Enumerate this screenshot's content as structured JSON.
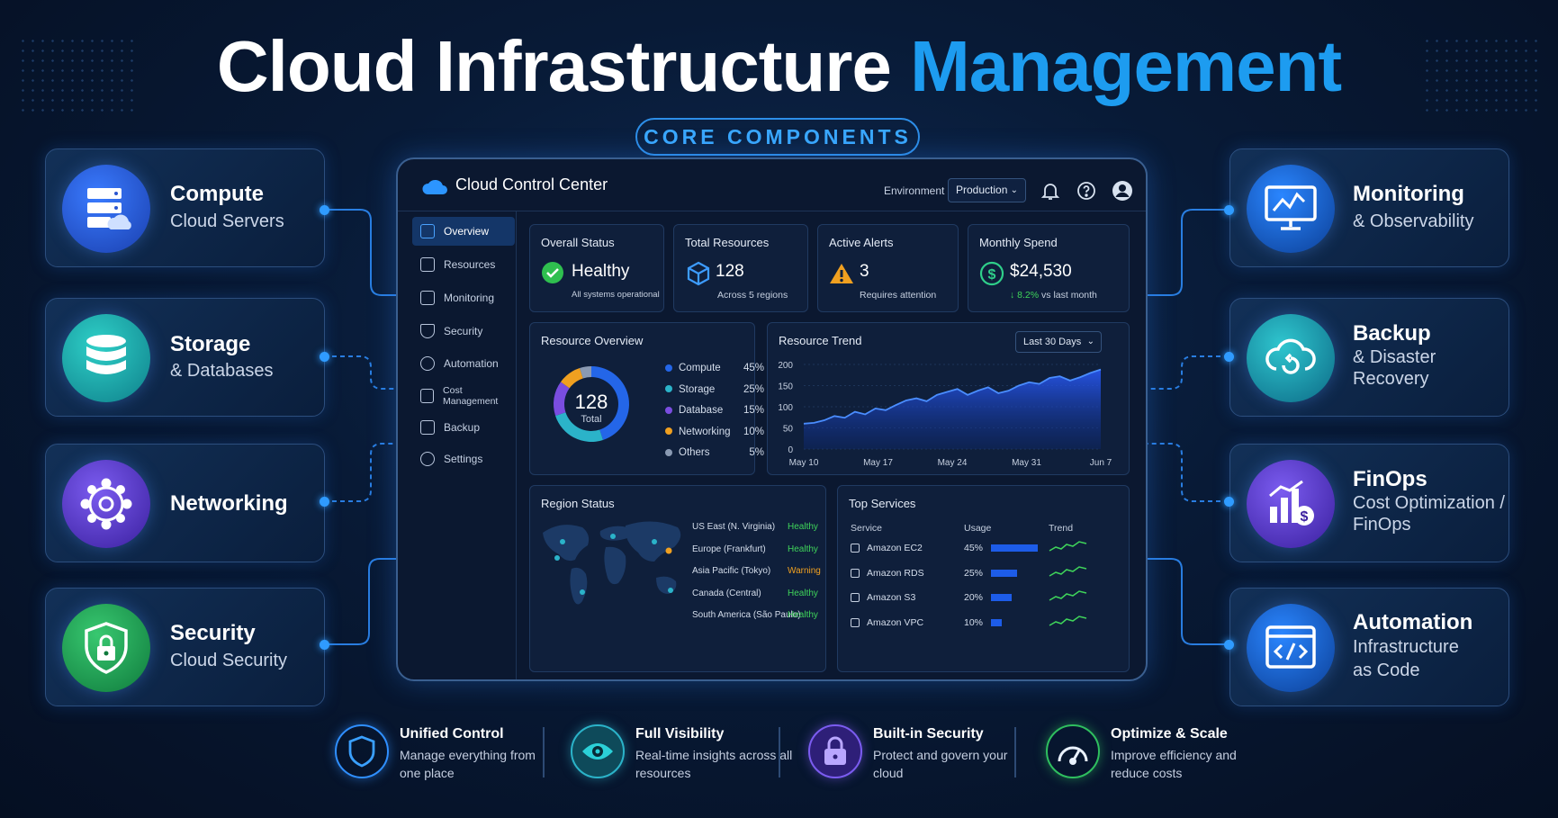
{
  "page_title": {
    "main": "Cloud Infrastructure",
    "accent": "Management"
  },
  "badge": "CORE COMPONENTS",
  "left_cards": [
    {
      "title": "Compute",
      "sub": [
        "Cloud Servers"
      ],
      "icon": "server-cloud-icon"
    },
    {
      "title": "Storage",
      "sub": [
        "& Databases"
      ],
      "icon": "database-icon"
    },
    {
      "title": "Networking",
      "sub": [],
      "icon": "network-hub-icon"
    },
    {
      "title": "Security",
      "sub": [
        "Cloud Security"
      ],
      "icon": "shield-lock-icon"
    }
  ],
  "right_cards": [
    {
      "title": "Monitoring",
      "sub": [
        "& Observability"
      ],
      "icon": "monitor-chart-icon"
    },
    {
      "title": "Backup",
      "sub": [
        "& Disaster",
        "Recovery"
      ],
      "icon": "cloud-backup-icon"
    },
    {
      "title": "FinOps",
      "sub": [
        "Cost Optimization /",
        "FinOps"
      ],
      "icon": "cost-chart-icon"
    },
    {
      "title": "Automation",
      "sub": [
        "Infrastructure",
        "as Code"
      ],
      "icon": "code-window-icon"
    }
  ],
  "dashboard": {
    "brand": "Cloud Control Center",
    "env_label": "Environment",
    "env_value": "Production",
    "nav": [
      "Overview",
      "Resources",
      "Monitoring",
      "Security",
      "Automation",
      "Cost Management",
      "Backup",
      "Settings"
    ],
    "kpis": [
      {
        "label": "Overall Status",
        "value": "Healthy",
        "sub": "All systems operational",
        "icon": "check-circle-icon"
      },
      {
        "label": "Total Resources",
        "value": "128",
        "sub": "Across 5 regions",
        "icon": "cube-icon"
      },
      {
        "label": "Active Alerts",
        "value": "3",
        "sub": "Requires attention",
        "icon": "warning-icon"
      },
      {
        "label": "Monthly Spend",
        "value": "$24,530",
        "sub_delta": "↓ 8.2%",
        "sub_rest": "vs last month",
        "icon": "dollar-icon"
      }
    ],
    "resource_overview": {
      "title": "Resource Overview",
      "center_value": "128",
      "center_label": "Total"
    },
    "resource_trend": {
      "title": "Resource Trend",
      "range": "Last 30 Days"
    },
    "region_status": {
      "title": "Region Status",
      "regions": [
        {
          "name": "US East (N. Virginia)",
          "status": "Healthy"
        },
        {
          "name": "Europe (Frankfurt)",
          "status": "Healthy"
        },
        {
          "name": "Asia Pacific (Tokyo)",
          "status": "Warning"
        },
        {
          "name": "Canada (Central)",
          "status": "Healthy"
        },
        {
          "name": "South America (São Paulo)",
          "status": "Healthy"
        }
      ]
    },
    "top_services": {
      "title": "Top Services",
      "headers": [
        "Service",
        "Usage",
        "Trend"
      ],
      "rows": [
        {
          "name": "Amazon EC2",
          "usage": "45%",
          "pct": 0.45
        },
        {
          "name": "Amazon RDS",
          "usage": "25%",
          "pct": 0.25
        },
        {
          "name": "Amazon S3",
          "usage": "20%",
          "pct": 0.2
        },
        {
          "name": "Amazon VPC",
          "usage": "10%",
          "pct": 0.1
        }
      ]
    }
  },
  "features": [
    {
      "title": "Unified Control",
      "sub": "Manage everything from one place",
      "icon": "shield-icon"
    },
    {
      "title": "Full Visibility",
      "sub": "Real-time insights across all resources",
      "icon": "eye-icon"
    },
    {
      "title": "Built-in Security",
      "sub": "Protect and govern your cloud",
      "icon": "padlock-icon"
    },
    {
      "title": "Optimize & Scale",
      "sub": "Improve efficiency and reduce costs",
      "icon": "gauge-icon"
    }
  ],
  "colors": {
    "accent": "#1d9cf0",
    "healthy": "#3fd45a",
    "warning": "#f0a020",
    "compute": "#2466e8",
    "storage": "#2bb3c9",
    "database": "#7a4de0",
    "networking": "#f0a020",
    "others": "#8a9ab3"
  },
  "chart_data": [
    {
      "type": "pie",
      "title": "Resource Overview",
      "categories": [
        "Compute",
        "Storage",
        "Database",
        "Networking",
        "Others"
      ],
      "values": [
        45,
        25,
        15,
        10,
        5
      ],
      "labels": [
        "45%",
        "25%",
        "15%",
        "10%",
        "5%"
      ],
      "legend": "right"
    },
    {
      "type": "area",
      "title": "Resource Trend",
      "x_ticks": [
        "May 10",
        "May 17",
        "May 24",
        "May 31",
        "Jun 7"
      ],
      "y_ticks": [
        "0",
        "50",
        "100",
        "150",
        "200"
      ],
      "ylim": [
        0,
        200
      ],
      "series": [
        {
          "values": [
            60,
            62,
            68,
            78,
            74,
            88,
            82,
            96,
            92,
            104,
            115,
            120,
            113,
            128,
            135,
            142,
            128,
            138,
            146,
            132,
            138,
            150,
            158,
            154,
            168,
            172,
            162,
            170,
            180,
            188
          ]
        }
      ]
    }
  ]
}
